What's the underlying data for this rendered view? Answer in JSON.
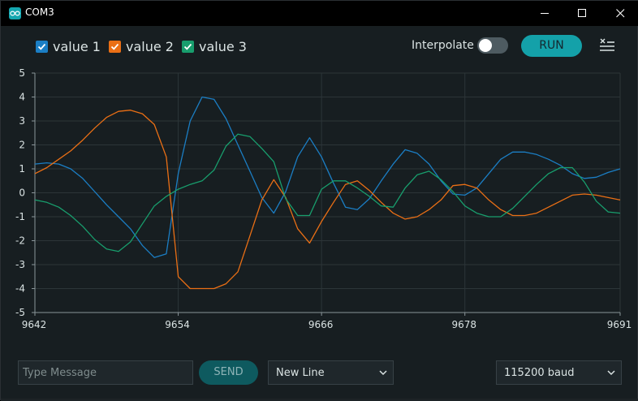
{
  "window": {
    "title": "COM3"
  },
  "legend": [
    {
      "label": "value 1",
      "color": "#1b7ec4"
    },
    {
      "label": "value 2",
      "color": "#ea6f15"
    },
    {
      "label": "value 3",
      "color": "#189e6d"
    }
  ],
  "toolbar": {
    "interpolate_label": "Interpolate",
    "interpolate_on": false,
    "run_label": "RUN",
    "menu_icon": "clear-list-icon"
  },
  "footer": {
    "message_placeholder": "Type Message",
    "send_label": "SEND",
    "line_ending": "New Line",
    "baud": "115200 baud"
  },
  "chart_data": {
    "type": "line",
    "xlim": [
      9642,
      9691
    ],
    "ylim": [
      -5,
      5
    ],
    "xticks": [
      9642,
      9654,
      9666,
      9678,
      9691
    ],
    "yticks": [
      5,
      4,
      3,
      2,
      1,
      0,
      -1,
      -2,
      -3,
      -4,
      -5
    ],
    "grid": true,
    "x": [
      9642,
      9643,
      9644,
      9645,
      9646,
      9647,
      9648,
      9649,
      9650,
      9651,
      9652,
      9653,
      9654,
      9655,
      9656,
      9657,
      9658,
      9659,
      9660,
      9661,
      9662,
      9663,
      9664,
      9665,
      9666,
      9667,
      9668,
      9669,
      9670,
      9671,
      9672,
      9673,
      9674,
      9675,
      9676,
      9677,
      9678,
      9679,
      9680,
      9681,
      9682,
      9683,
      9684,
      9685,
      9686,
      9687,
      9688,
      9689,
      9690,
      9691
    ],
    "series": [
      {
        "name": "value 1",
        "color": "#1b7ec4",
        "values": [
          1.2,
          1.25,
          1.2,
          1.0,
          0.6,
          0.05,
          -0.5,
          -1.0,
          -1.5,
          -2.2,
          -2.7,
          -2.55,
          0.8,
          3.0,
          4.0,
          3.9,
          3.1,
          2.0,
          0.9,
          -0.2,
          -0.85,
          0.05,
          1.5,
          2.3,
          1.5,
          0.4,
          -0.6,
          -0.7,
          -0.25,
          0.5,
          1.2,
          1.8,
          1.65,
          1.2,
          0.5,
          -0.05,
          -0.1,
          0.2,
          0.8,
          1.4,
          1.7,
          1.7,
          1.6,
          1.4,
          1.15,
          0.8,
          0.6,
          0.65,
          0.85,
          1.0
        ]
      },
      {
        "name": "value 2",
        "color": "#ea6f15",
        "values": [
          0.8,
          1.05,
          1.4,
          1.75,
          2.2,
          2.7,
          3.15,
          3.4,
          3.45,
          3.3,
          2.85,
          1.5,
          -3.5,
          -4.0,
          -4.0,
          -4.0,
          -3.8,
          -3.3,
          -1.8,
          -0.3,
          0.55,
          -0.2,
          -1.5,
          -2.1,
          -1.2,
          -0.4,
          0.35,
          0.5,
          0.1,
          -0.4,
          -0.85,
          -1.1,
          -1.0,
          -0.7,
          -0.3,
          0.3,
          0.35,
          0.2,
          -0.3,
          -0.7,
          -0.95,
          -0.95,
          -0.85,
          -0.6,
          -0.35,
          -0.1,
          -0.05,
          -0.1,
          -0.2,
          -0.3
        ]
      },
      {
        "name": "value 3",
        "color": "#189e6d",
        "values": [
          -0.3,
          -0.4,
          -0.6,
          -0.95,
          -1.4,
          -1.95,
          -2.35,
          -2.45,
          -2.05,
          -1.3,
          -0.55,
          -0.15,
          0.15,
          0.35,
          0.5,
          0.95,
          1.95,
          2.45,
          2.35,
          1.85,
          1.3,
          -0.25,
          -0.95,
          -0.95,
          0.15,
          0.5,
          0.5,
          0.2,
          -0.15,
          -0.55,
          -0.6,
          0.2,
          0.75,
          0.9,
          0.55,
          0.05,
          -0.55,
          -0.85,
          -1.0,
          -1.0,
          -0.65,
          -0.15,
          0.35,
          0.8,
          1.05,
          1.05,
          0.45,
          -0.35,
          -0.8,
          -0.85
        ]
      }
    ]
  }
}
